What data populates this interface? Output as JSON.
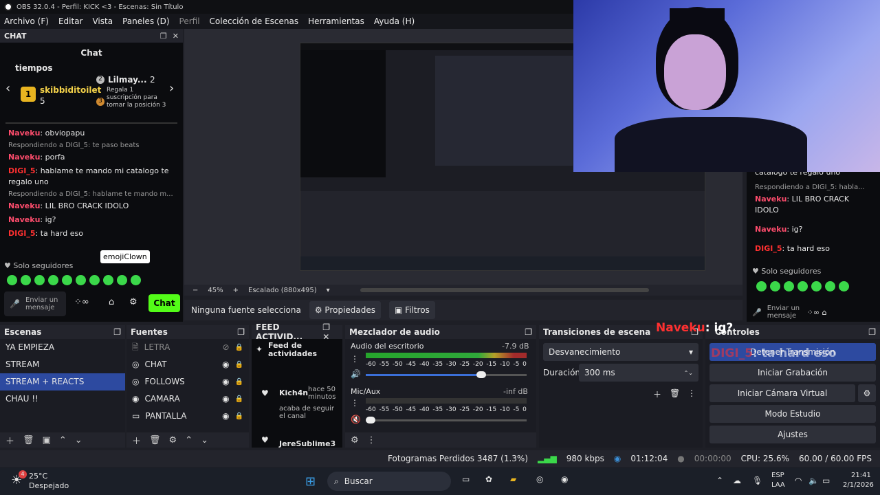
{
  "window": {
    "title": "OBS 32.0.4 - Perfil: KICK <3 - Escenas: Sin Título"
  },
  "menu": [
    "Archivo (F)",
    "Editar",
    "Vista",
    "Paneles (D)",
    "Perfil",
    "Colección de Escenas",
    "Herramientas",
    "Ayuda (H)"
  ],
  "chat_dock": {
    "title": "CHAT",
    "header": "Chat",
    "leaderboard_label": "tiempos",
    "user1": "skibbiditoilet",
    "user1_rank": "1",
    "user1_count": "5",
    "user2": "Lilmay...",
    "user2_rank": "2",
    "user2_count": "2",
    "gift_text": "Regala 1 suscripción para tomar la posición 3",
    "gift_rank": "3",
    "messages": [
      {
        "type": "msg",
        "name": "Naveku",
        "text": ": obviopapu"
      },
      {
        "type": "reply",
        "text": "Respondiendo a DIGI_5: te paso beats"
      },
      {
        "type": "msg",
        "name": "Naveku",
        "text": ": porfa"
      },
      {
        "type": "msg",
        "name": "DIGI_5",
        "text": ": hablame te mando mi catalogo te regalo uno"
      },
      {
        "type": "reply",
        "text": "Respondiendo a DIGI_5: hablame te mando m..."
      },
      {
        "type": "msg",
        "name": "Naveku",
        "text": ": LIL BRO CRACK IDOLO"
      },
      {
        "type": "msg",
        "name": "Naveku",
        "text": ": ig?"
      },
      {
        "type": "msg",
        "name": "DIGI_5",
        "text": ": ta hard eso"
      }
    ],
    "tooltip": "emojiClown",
    "followers_only": "Solo seguidores",
    "send_placeholder": "Enviar un mensaje",
    "chat_button": "Chat"
  },
  "right_chat": {
    "line0": "catalogo te regalo uno",
    "reply": "Respondiendo a DIGI_5: habla...",
    "m1_name": "Naveku",
    "m1_text": ": LIL BRO CRACK IDOLO",
    "m2_name": "Naveku",
    "m2_text": ": ig?",
    "m3_name": "DIGI_5",
    "m3_text": ": ta hard eso",
    "followers_only": "Solo seguidores",
    "send_placeholder": "Enviar un mensaje"
  },
  "preview": {
    "zoom": "45%",
    "scale": "Escalado (880x495)"
  },
  "source_bar": {
    "none": "Ninguna fuente selecciona",
    "properties": "Propiedades",
    "filters": "Filtros"
  },
  "scenes": {
    "title": "Escenas",
    "items": [
      "YA EMPIEZA",
      "STREAM",
      "STREAM + REACTS",
      "CHAU !!"
    ],
    "selected": 2
  },
  "sources": {
    "title": "Fuentes",
    "items": [
      "LETRA",
      "CHAT",
      "FOLLOWS",
      "CAMARA",
      "PANTALLA"
    ]
  },
  "feed": {
    "title": "FEED ACTIVID...",
    "header": "Feed de actividades",
    "e1_name": "Kich4n",
    "e1_time": "hace 50 minutos",
    "e1_text": "acaba de seguir el canal",
    "e2_name": "JereSublime3"
  },
  "mixer": {
    "title": "Mezclador de audio",
    "ch1": "Audio del escritorio",
    "ch1_db": "-7.9 dB",
    "ch1_level": 0.72,
    "ch2": "Mic/Aux",
    "ch2_db": "-inf dB",
    "ch2_level": 0.0,
    "ticks": [
      "-60",
      "-55",
      "-50",
      "-45",
      "-40",
      "-35",
      "-30",
      "-25",
      "-20",
      "-15",
      "-10",
      "-5",
      "0"
    ]
  },
  "transitions": {
    "title": "Transiciones de escena",
    "type": "Desvanecimiento",
    "duration_label": "Duración",
    "duration": "300 ms"
  },
  "controls": {
    "title": "Controles",
    "overlay_name": "Naveku",
    "overlay_text": "ig?",
    "overlay2_name": "DIGI_5",
    "overlay2_text": "ta hard eso",
    "stop_stream": "Detener Transmisión",
    "record": "Iniciar Grabación",
    "virtual_cam": "Iniciar Cámara Virtual",
    "studio": "Modo Estudio",
    "settings": "Ajustes"
  },
  "status": {
    "dropped": "Fotogramas Perdidos 3487 (1.3%)",
    "kbps": "980 kbps",
    "stream_time": "01:12:04",
    "rec_time": "00:00:00",
    "cpu": "CPU: 25.6%",
    "fps": "60.00 / 60.00 FPS"
  },
  "taskbar": {
    "weather_temp": "25°C",
    "weather_text": "Despejado",
    "weather_badge": "4",
    "search": "Buscar",
    "lang1": "ESP",
    "lang2": "LAA",
    "time": "21:41",
    "date": "2/1/2026"
  }
}
